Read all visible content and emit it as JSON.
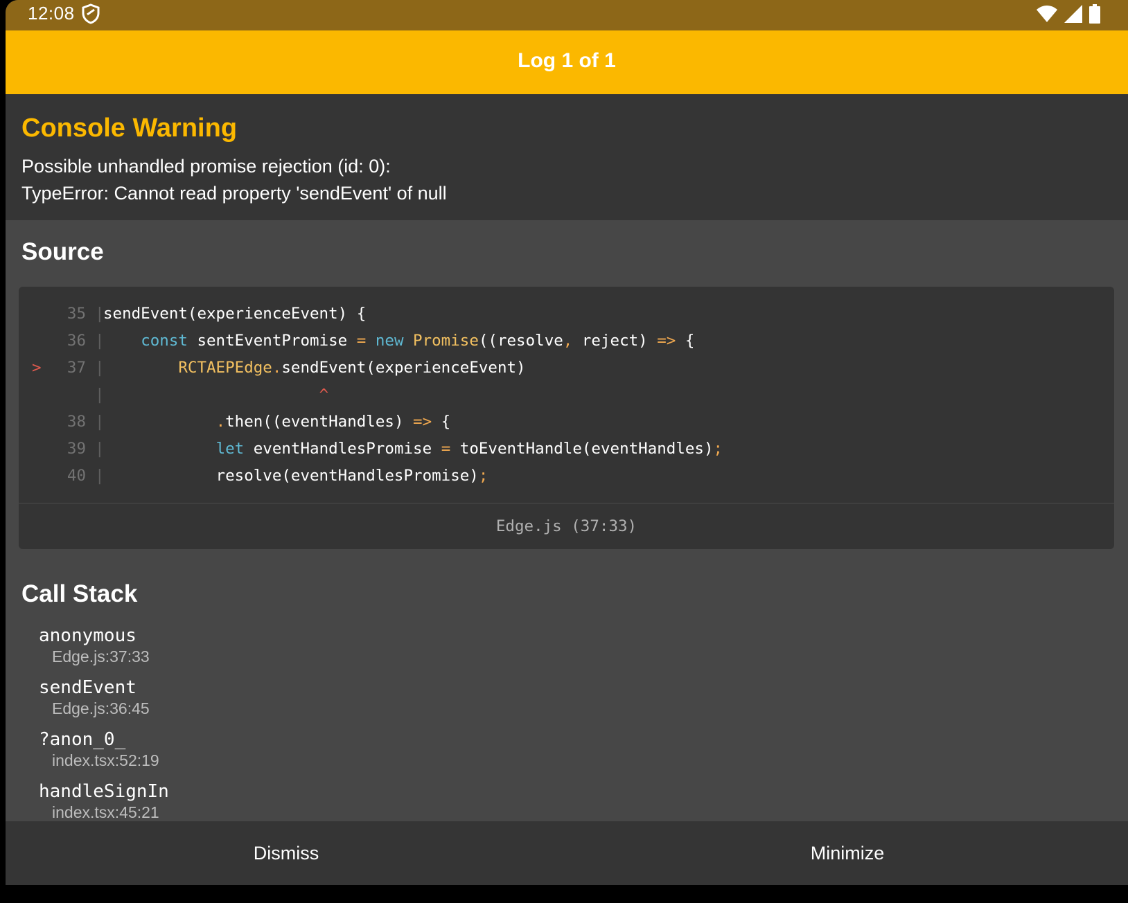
{
  "status_bar": {
    "time": "12:08",
    "icons": [
      "shield-icon",
      "wifi-icon",
      "cell-signal-icon",
      "battery-icon"
    ]
  },
  "header": {
    "title": "Log 1 of 1",
    "color": "#fbb800"
  },
  "warning": {
    "title": "Console Warning",
    "message": "Possible unhandled promise rejection (id: 0):\nTypeError: Cannot read property 'sendEvent' of null"
  },
  "source": {
    "title": "Source",
    "lines": [
      {
        "marker": "",
        "num": "35",
        "tokens": [
          {
            "t": "sendEvent(experienceEvent) {",
            "c": ""
          }
        ]
      },
      {
        "marker": "",
        "num": "36",
        "tokens": [
          {
            "t": "    ",
            "c": ""
          },
          {
            "t": "const",
            "c": "kw"
          },
          {
            "t": " sentEventPromise ",
            "c": ""
          },
          {
            "t": "=",
            "c": "op"
          },
          {
            "t": " ",
            "c": ""
          },
          {
            "t": "new",
            "c": "kw"
          },
          {
            "t": " ",
            "c": ""
          },
          {
            "t": "Promise",
            "c": "cls"
          },
          {
            "t": "((resolve",
            "c": ""
          },
          {
            "t": ",",
            "c": "op"
          },
          {
            "t": " reject) ",
            "c": ""
          },
          {
            "t": "=>",
            "c": "op"
          },
          {
            "t": " {",
            "c": ""
          }
        ]
      },
      {
        "marker": ">",
        "num": "37",
        "tokens": [
          {
            "t": "        ",
            "c": ""
          },
          {
            "t": "RCTAEPEdge",
            "c": "cls"
          },
          {
            "t": ".",
            "c": "op"
          },
          {
            "t": "sendEvent(experienceEvent)",
            "c": ""
          }
        ]
      },
      {
        "marker": "",
        "num": "",
        "tokens": [
          {
            "t": "                       ",
            "c": ""
          },
          {
            "t": "^",
            "c": "err"
          }
        ]
      },
      {
        "marker": "",
        "num": "38",
        "tokens": [
          {
            "t": "            ",
            "c": ""
          },
          {
            "t": ".",
            "c": "op"
          },
          {
            "t": "then((eventHandles) ",
            "c": ""
          },
          {
            "t": "=>",
            "c": "op"
          },
          {
            "t": " {",
            "c": ""
          }
        ]
      },
      {
        "marker": "",
        "num": "39",
        "tokens": [
          {
            "t": "            ",
            "c": ""
          },
          {
            "t": "let",
            "c": "kw"
          },
          {
            "t": " eventHandlesPromise ",
            "c": ""
          },
          {
            "t": "=",
            "c": "op"
          },
          {
            "t": " toEventHandle(eventHandles)",
            "c": ""
          },
          {
            "t": ";",
            "c": "op"
          }
        ]
      },
      {
        "marker": "",
        "num": "40",
        "tokens": [
          {
            "t": "            resolve(eventHandlesPromise)",
            "c": ""
          },
          {
            "t": ";",
            "c": "op"
          }
        ]
      }
    ],
    "location": "Edge.js (37:33)"
  },
  "call_stack": {
    "title": "Call Stack",
    "frames": [
      {
        "fn": "anonymous",
        "loc": "Edge.js:37:33"
      },
      {
        "fn": "sendEvent",
        "loc": "Edge.js:36:45"
      },
      {
        "fn": "?anon_0_",
        "loc": "index.tsx:52:19"
      },
      {
        "fn": "handleSignIn",
        "loc": "index.tsx:45:21"
      }
    ]
  },
  "footer": {
    "dismiss_label": "Dismiss",
    "minimize_label": "Minimize"
  }
}
